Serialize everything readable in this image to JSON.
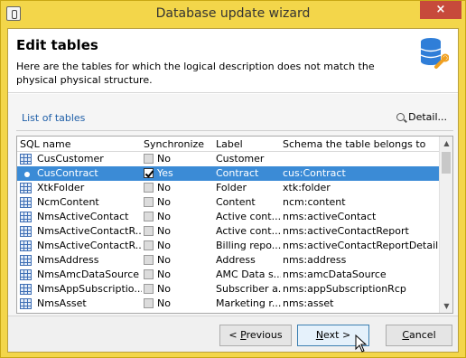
{
  "window": {
    "title": "Database update wizard",
    "close_label": "×"
  },
  "header": {
    "title": "Edit tables",
    "description": "Here are the tables for which the logical description does not match the physical physical structure.",
    "icon": "database-settings-icon"
  },
  "section": {
    "link_label": "List of tables",
    "detail_label": "Detail..."
  },
  "table": {
    "columns": [
      "SQL name",
      "Synchronize",
      "Label",
      "Schema the table belongs to"
    ],
    "rows": [
      {
        "name": "CusCustomer",
        "sync": "No",
        "checked": false,
        "label": "Customer",
        "schema": ""
      },
      {
        "name": "CusContract",
        "sync": "Yes",
        "checked": true,
        "label": "Contract",
        "schema": "cus:Contract",
        "selected": true
      },
      {
        "name": "XtkFolder",
        "sync": "No",
        "checked": false,
        "label": "Folder",
        "schema": "xtk:folder"
      },
      {
        "name": "NcmContent",
        "sync": "No",
        "checked": false,
        "label": "Content",
        "schema": "ncm:content"
      },
      {
        "name": "NmsActiveContact",
        "sync": "No",
        "checked": false,
        "label": "Active cont...",
        "schema": "nms:activeContact"
      },
      {
        "name": "NmsActiveContactR...",
        "sync": "No",
        "checked": false,
        "label": "Active cont...",
        "schema": "nms:activeContactReport"
      },
      {
        "name": "NmsActiveContactR...",
        "sync": "No",
        "checked": false,
        "label": "Billing repo...",
        "schema": "nms:activeContactReportDetail"
      },
      {
        "name": "NmsAddress",
        "sync": "No",
        "checked": false,
        "label": "Address",
        "schema": "nms:address"
      },
      {
        "name": "NmsAmcDataSource",
        "sync": "No",
        "checked": false,
        "label": "AMC Data s...",
        "schema": "nms:amcDataSource"
      },
      {
        "name": "NmsAppSubscriptio...",
        "sync": "No",
        "checked": false,
        "label": "Subscriber a...",
        "schema": "nms:appSubscriptionRcp"
      },
      {
        "name": "NmsAsset",
        "sync": "No",
        "checked": false,
        "label": "Marketing r...",
        "schema": "nms:asset"
      }
    ]
  },
  "buttons": {
    "previous": "< Previous",
    "next": "Next >",
    "cancel": "Cancel"
  }
}
